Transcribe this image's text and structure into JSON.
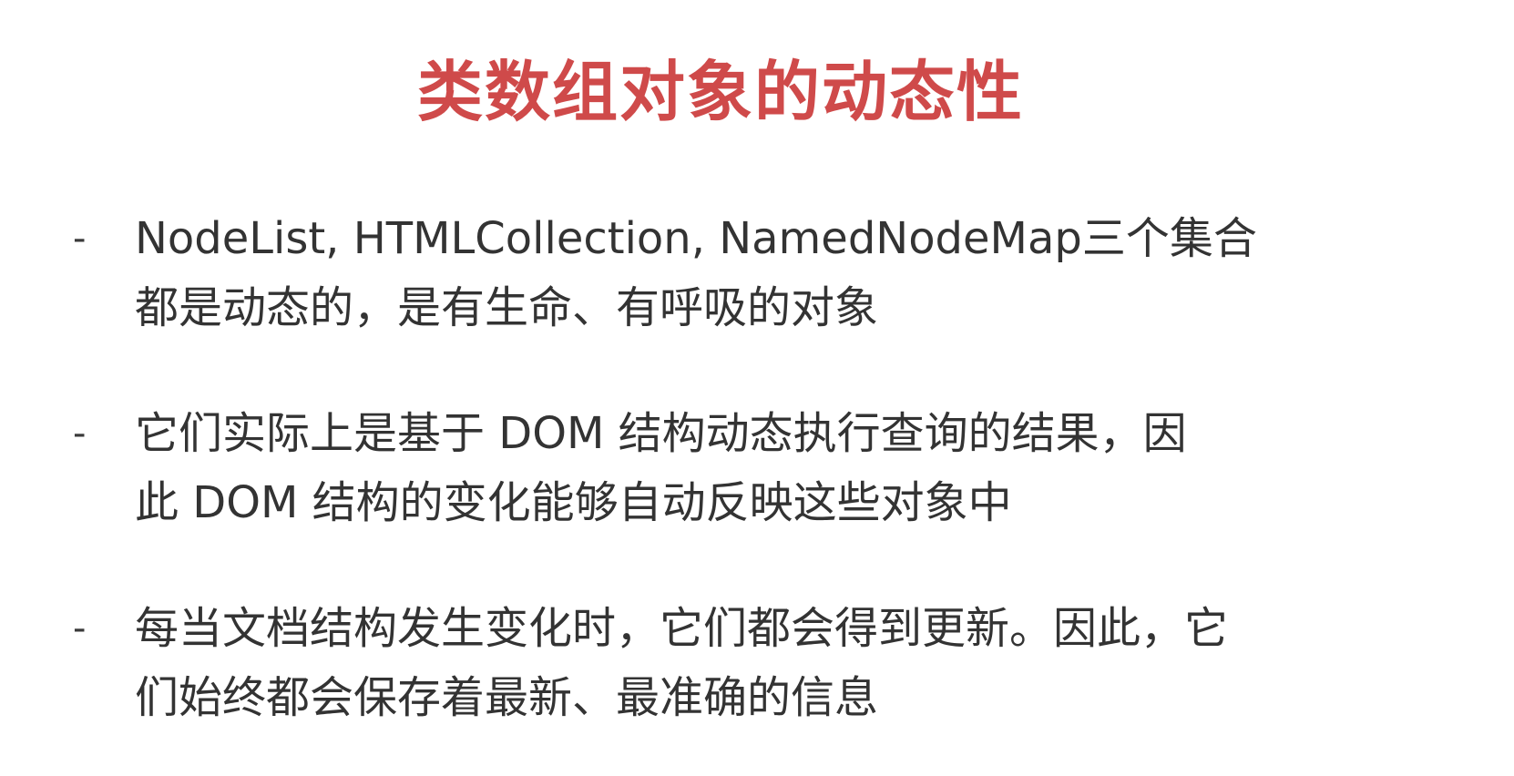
{
  "slide": {
    "title": "类数组对象的动态性",
    "bullets": [
      {
        "dash": "-",
        "lines": [
          "NodeList, HTMLCollection, NamedNodeMap三个集合",
          "都是动态的，是有生命、有呼吸的对象"
        ]
      },
      {
        "dash": "-",
        "lines": [
          "它们实际上是基于 DOM 结构动态执行查询的结果，因",
          "此 DOM 结构的变化能够自动反映这些对象中"
        ]
      },
      {
        "dash": "-",
        "lines": [
          "每当文档结构发生变化时，它们都会得到更新。因此，它",
          "们始终都会保存着最新、最准确的信息"
        ]
      }
    ],
    "colors": {
      "title": "#cf4a4a",
      "body_text": "#333333",
      "background": "#ffffff"
    }
  }
}
